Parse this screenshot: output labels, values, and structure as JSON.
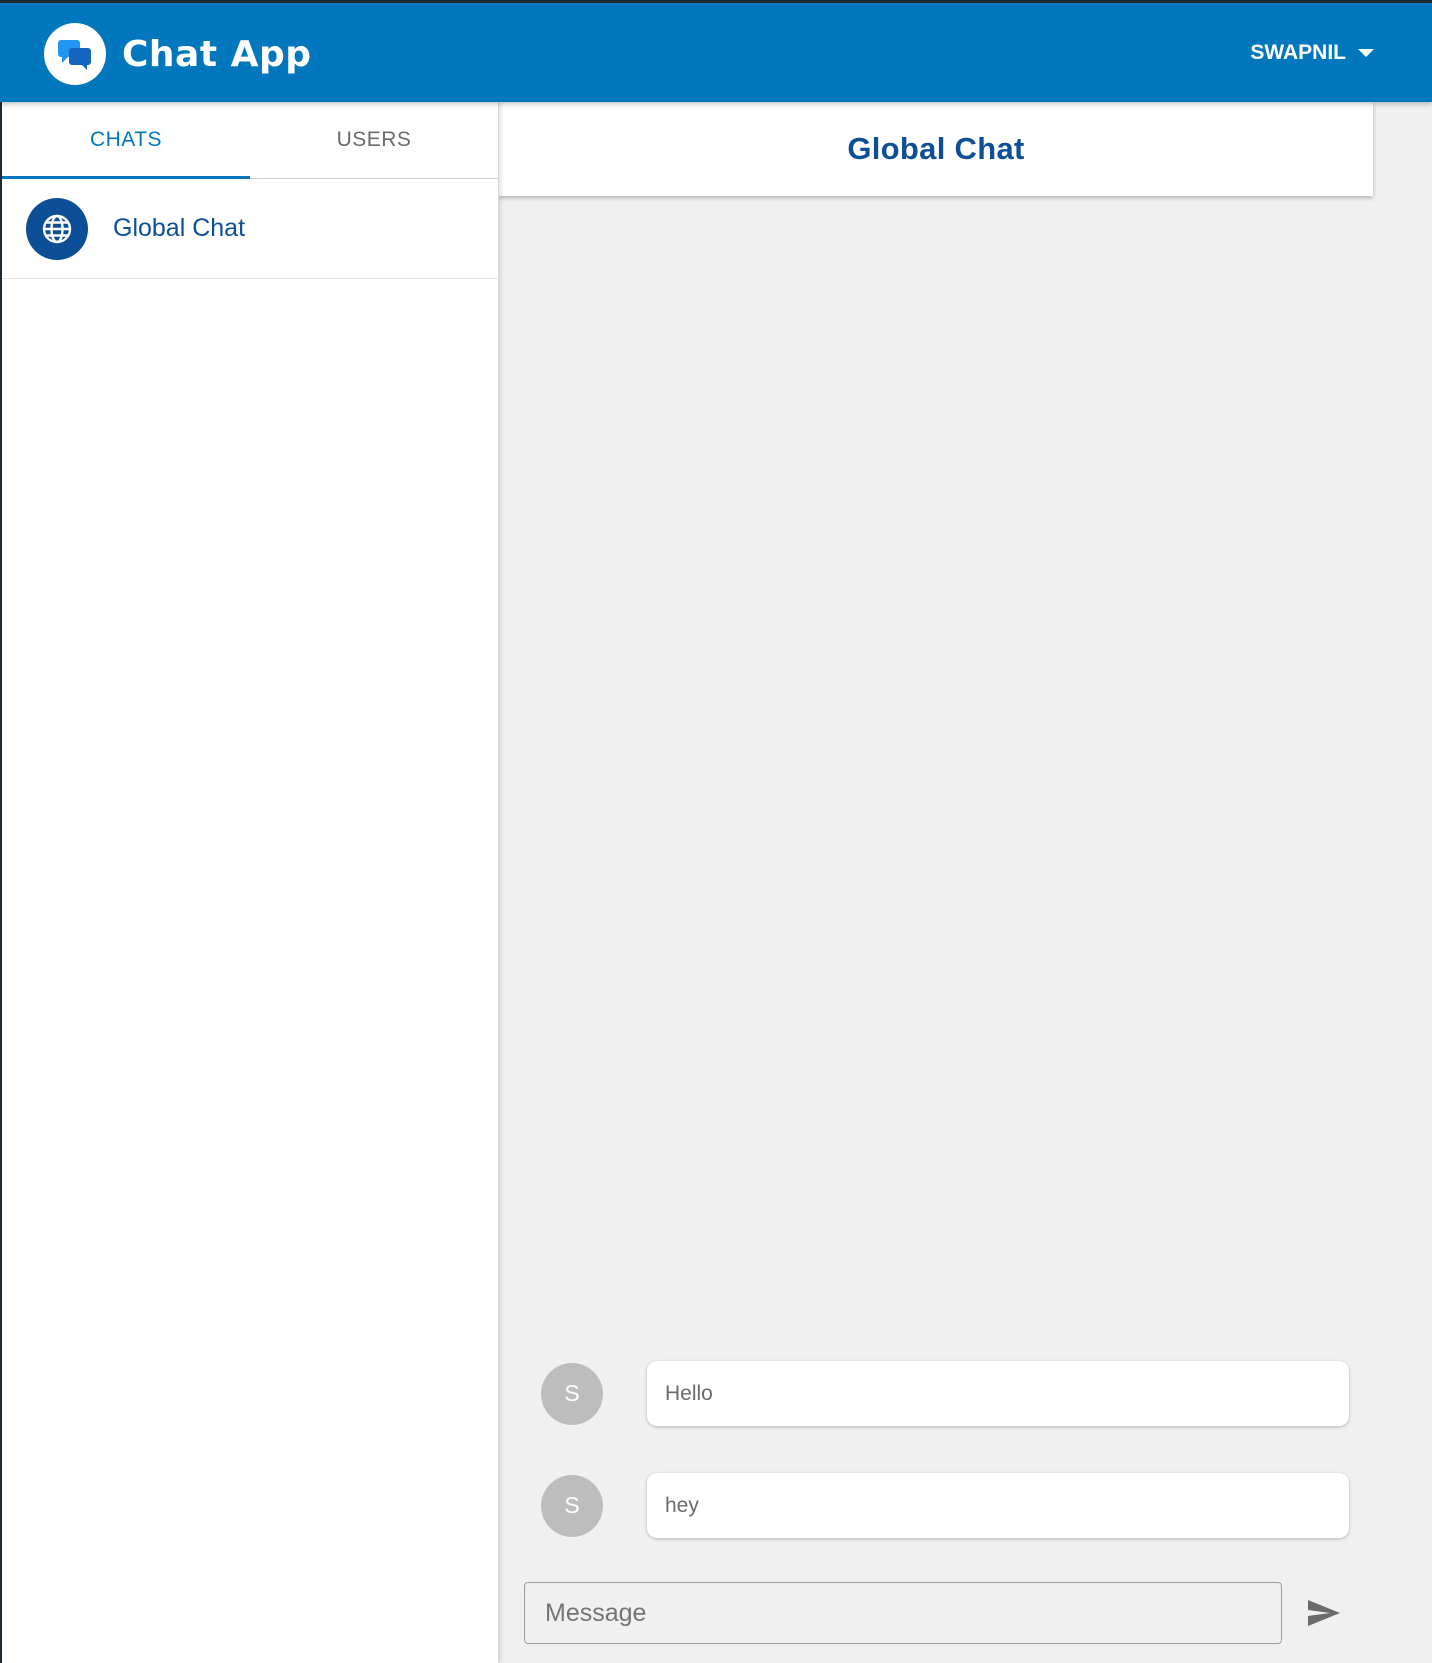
{
  "app": {
    "title": "Chat App",
    "user_name": "SWAPNIL"
  },
  "sidebar": {
    "tabs": [
      {
        "label": "CHATS",
        "active": true
      },
      {
        "label": "USERS",
        "active": false
      }
    ],
    "chats": [
      {
        "name": "Global Chat",
        "icon": "globe-icon"
      }
    ]
  },
  "conversation": {
    "title": "Global Chat",
    "messages": [
      {
        "avatar_initial": "S",
        "text": "Hello"
      },
      {
        "avatar_initial": "S",
        "text": "hey"
      }
    ]
  },
  "composer": {
    "placeholder": "Message",
    "send_icon": "send-icon"
  },
  "colors": {
    "primary": "#0277bd",
    "accent_dark": "#0d4f96",
    "background": "#f0f0f0",
    "avatar_grey": "#bdbdbd"
  }
}
